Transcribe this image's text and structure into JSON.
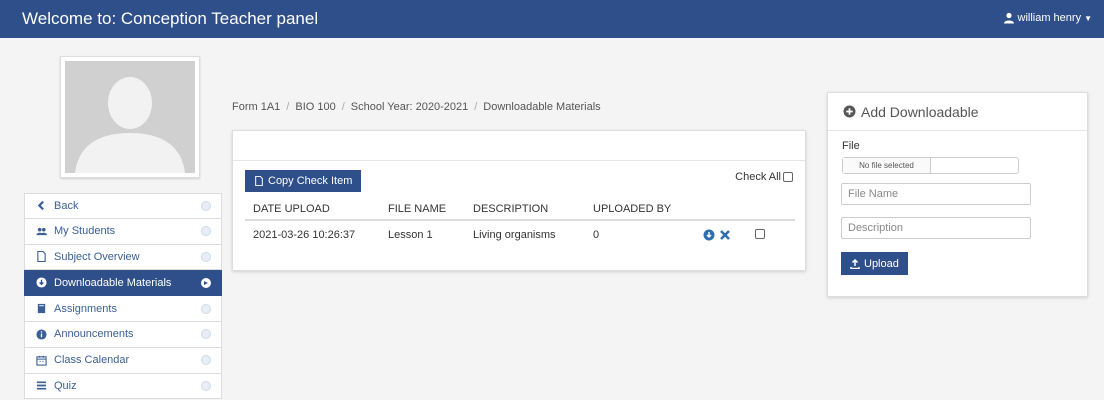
{
  "header": {
    "title": "Welcome to: Conception Teacher panel",
    "user": "william henry"
  },
  "breadcrumb": [
    "Form 1A1",
    "BIO 100",
    "School Year: 2020-2021",
    "Downloadable Materials"
  ],
  "sidebar": {
    "items": [
      {
        "label": "Back",
        "icon": "chevron-left-icon"
      },
      {
        "label": "My Students",
        "icon": "users-icon"
      },
      {
        "label": "Subject Overview",
        "icon": "file-icon"
      },
      {
        "label": "Downloadable Materials",
        "icon": "download-circle-icon",
        "active": true
      },
      {
        "label": "Assignments",
        "icon": "book-icon"
      },
      {
        "label": "Announcements",
        "icon": "info-icon"
      },
      {
        "label": "Class Calendar",
        "icon": "calendar-icon"
      },
      {
        "label": "Quiz",
        "icon": "list-icon"
      }
    ]
  },
  "materials": {
    "copy_button": "Copy Check Item",
    "check_all": "Check All",
    "columns": [
      "DATE UPLOAD",
      "FILE NAME",
      "DESCRIPTION",
      "UPLOADED BY"
    ],
    "rows": [
      {
        "date": "2021-03-26 10:26:37",
        "file_name": "Lesson 1",
        "description": "Living organisms",
        "uploaded_by": "0"
      }
    ]
  },
  "upload": {
    "title": "Add Downloadable",
    "file_label": "File",
    "file_status": "No file selected",
    "file_name_placeholder": "File Name",
    "description_placeholder": "Description",
    "upload_button": "Upload"
  },
  "colors": {
    "primary": "#2f4f8a",
    "background": "#f4f4f4"
  }
}
